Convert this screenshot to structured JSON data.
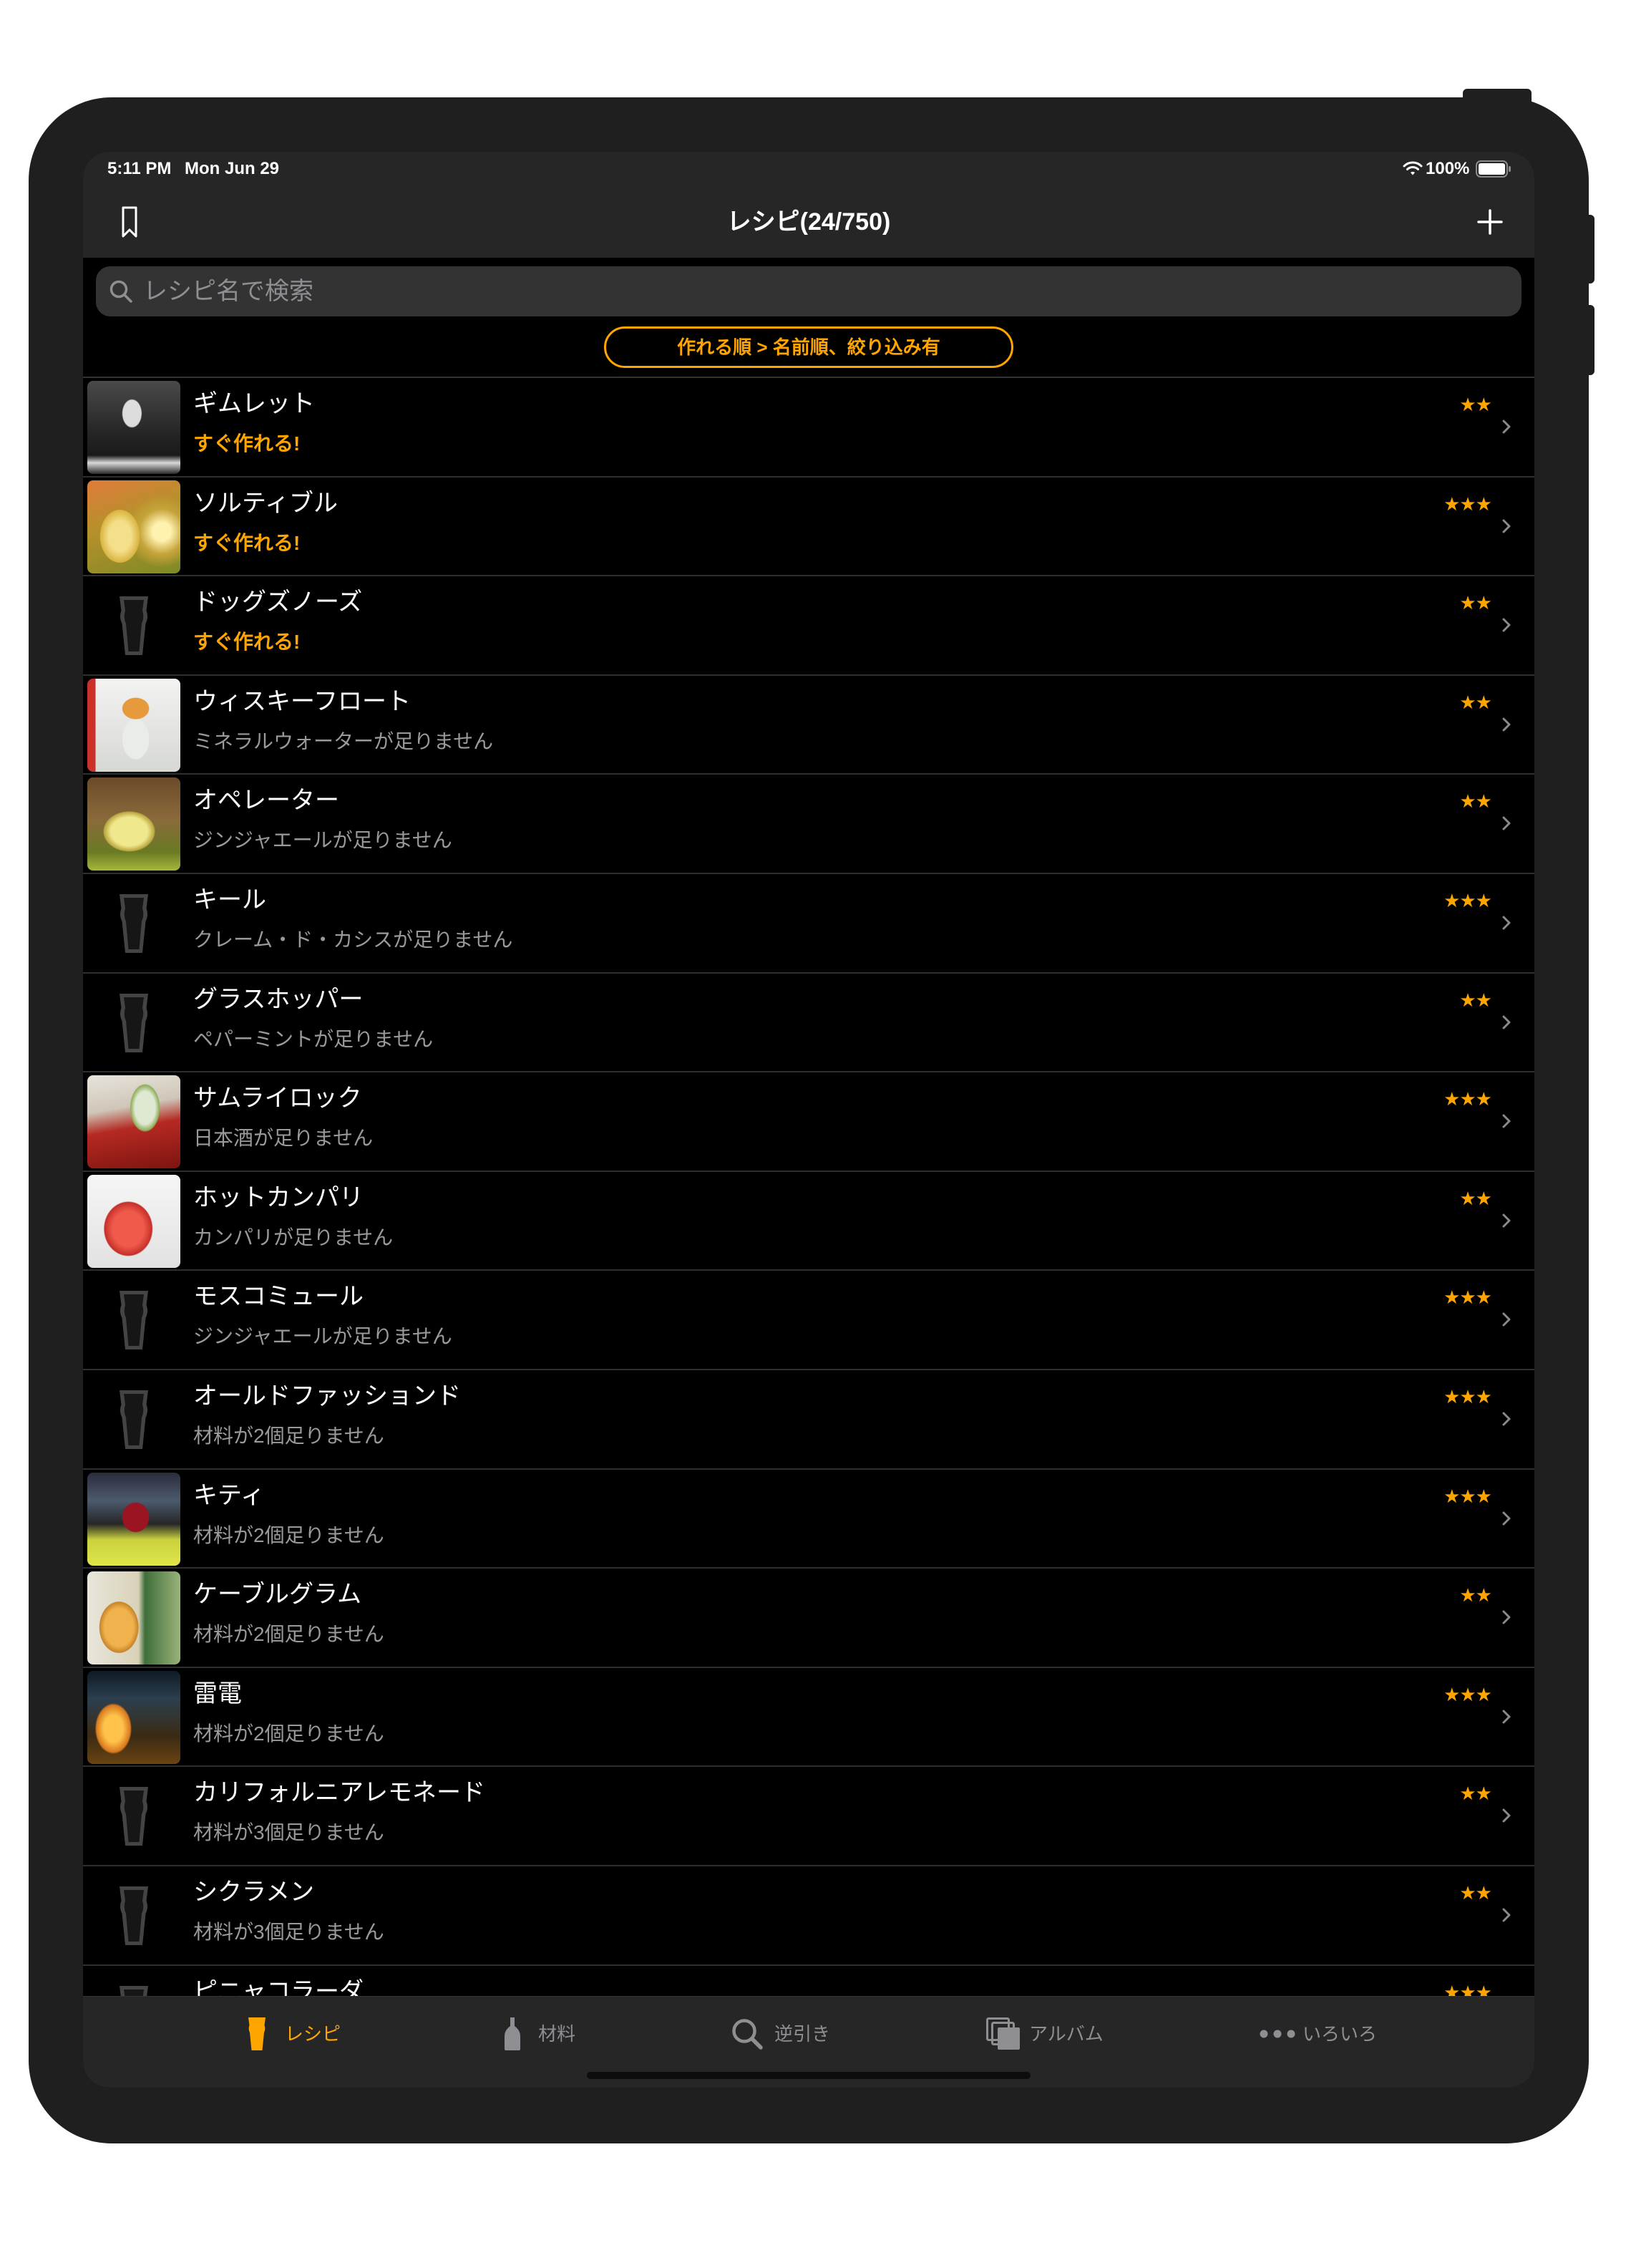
{
  "colors": {
    "accent": "#FFA500",
    "bar": "#262626",
    "background": "#000000",
    "muted_text": "#8E8E93"
  },
  "status_bar": {
    "time": "5:11 PM",
    "date": "Mon Jun 29",
    "battery": "100%",
    "wifi_icon": "wifi-icon",
    "battery_icon": "battery-icon"
  },
  "nav": {
    "title": "レシピ(24/750)",
    "left_icon": "bookmark-icon",
    "right_icon": "plus-icon"
  },
  "search": {
    "placeholder": "レシピ名で検索",
    "value": "",
    "icon": "search-icon"
  },
  "sort_button": {
    "label": "作れる順 > 名前順、絞り込み有"
  },
  "recipes": [
    {
      "name": "ギムレット",
      "status": "すぐ作れる!",
      "status_tone": "accent",
      "rating": 2,
      "photo": true
    },
    {
      "name": "ソルティブル",
      "status": "すぐ作れる!",
      "status_tone": "accent",
      "rating": 3,
      "photo": true
    },
    {
      "name": "ドッグズノーズ",
      "status": "すぐ作れる!",
      "status_tone": "accent",
      "rating": 2,
      "photo": false
    },
    {
      "name": "ウィスキーフロート",
      "status": "ミネラルウォーターが足りません",
      "status_tone": "muted",
      "rating": 2,
      "photo": true
    },
    {
      "name": "オペレーター",
      "status": "ジンジャエールが足りません",
      "status_tone": "muted",
      "rating": 2,
      "photo": true
    },
    {
      "name": "キール",
      "status": "クレーム・ド・カシスが足りません",
      "status_tone": "muted",
      "rating": 3,
      "photo": false
    },
    {
      "name": "グラスホッパー",
      "status": "ペパーミントが足りません",
      "status_tone": "muted",
      "rating": 2,
      "photo": false
    },
    {
      "name": "サムライロック",
      "status": "日本酒が足りません",
      "status_tone": "muted",
      "rating": 3,
      "photo": true
    },
    {
      "name": "ホットカンパリ",
      "status": "カンパリが足りません",
      "status_tone": "muted",
      "rating": 2,
      "photo": true
    },
    {
      "name": "モスコミュール",
      "status": "ジンジャエールが足りません",
      "status_tone": "muted",
      "rating": 3,
      "photo": false
    },
    {
      "name": "オールドファッションド",
      "status": "材料が2個足りません",
      "status_tone": "muted",
      "rating": 3,
      "photo": false
    },
    {
      "name": "キティ",
      "status": "材料が2個足りません",
      "status_tone": "muted",
      "rating": 3,
      "photo": true
    },
    {
      "name": "ケーブルグラム",
      "status": "材料が2個足りません",
      "status_tone": "muted",
      "rating": 2,
      "photo": true
    },
    {
      "name": "雷電",
      "status": "材料が2個足りません",
      "status_tone": "muted",
      "rating": 3,
      "photo": true
    },
    {
      "name": "カリフォルニアレモネード",
      "status": "材料が3個足りません",
      "status_tone": "muted",
      "rating": 2,
      "photo": false
    },
    {
      "name": "シクラメン",
      "status": "材料が3個足りません",
      "status_tone": "muted",
      "rating": 2,
      "photo": false
    },
    {
      "name": "ピニャコラーダ",
      "rating": 3,
      "photo": false
    }
  ],
  "tabs": [
    {
      "label": "レシピ",
      "icon": "glass-icon",
      "selected": true
    },
    {
      "label": "材料",
      "icon": "bottle-icon",
      "selected": false
    },
    {
      "label": "逆引き",
      "icon": "search-icon",
      "selected": false
    },
    {
      "label": "アルバム",
      "icon": "album-icon",
      "selected": false
    },
    {
      "label": "いろいろ",
      "icon": "more-icon",
      "selected": false
    }
  ]
}
